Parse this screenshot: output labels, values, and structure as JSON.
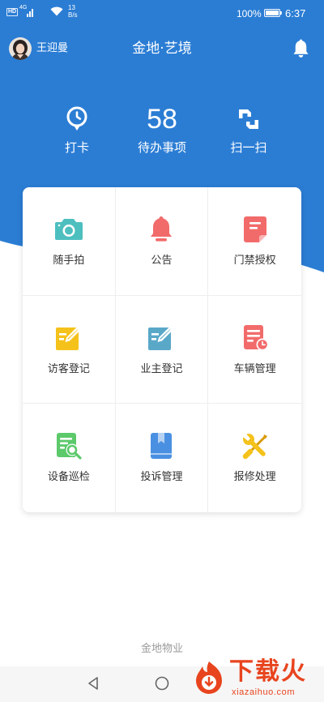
{
  "status_bar": {
    "hd": "HD",
    "network_type": "4G",
    "net_speed_value": "13",
    "net_speed_unit": "B/s",
    "battery_percent": "100%",
    "time": "6:37"
  },
  "header": {
    "user_name": "王迎曼",
    "title": "金地·艺境",
    "bell_icon": "notification-bell-icon"
  },
  "quick_actions": {
    "checkin_icon": "clock-pin-icon",
    "checkin_label": "打卡",
    "todo_count": "58",
    "todo_label": "待办事项",
    "scan_icon": "scan-icon",
    "scan_label": "扫一扫"
  },
  "grid": [
    {
      "label": "随手拍",
      "icon": "camera-icon",
      "color": "#4dbfbf"
    },
    {
      "label": "公告",
      "icon": "bell-icon",
      "color": "#f26b6b"
    },
    {
      "label": "门禁授权",
      "icon": "document-icon",
      "color": "#f26b6b"
    },
    {
      "label": "访客登记",
      "icon": "edit-icon",
      "color": "#f5c21b"
    },
    {
      "label": "业主登记",
      "icon": "edit-icon",
      "color": "#5aa8c8"
    },
    {
      "label": "车辆管理",
      "icon": "document-clock-icon",
      "color": "#f26b6b"
    },
    {
      "label": "设备巡检",
      "icon": "document-search-icon",
      "color": "#5cc96b"
    },
    {
      "label": "投诉管理",
      "icon": "book-icon",
      "color": "#4a90e2"
    },
    {
      "label": "报修处理",
      "icon": "tools-icon",
      "color": "#f5c21b"
    }
  ],
  "footer": {
    "company": "金地物业"
  },
  "nav_bar": {
    "back_icon": "back-triangle-icon",
    "home_icon": "home-circle-icon"
  },
  "watermark": {
    "brand": "下载火",
    "url": "xiazaihuo.com",
    "color": "#e8441e"
  },
  "colors": {
    "primary": "#2b7dd4",
    "text": "#333333",
    "muted": "#9a9a9a"
  }
}
